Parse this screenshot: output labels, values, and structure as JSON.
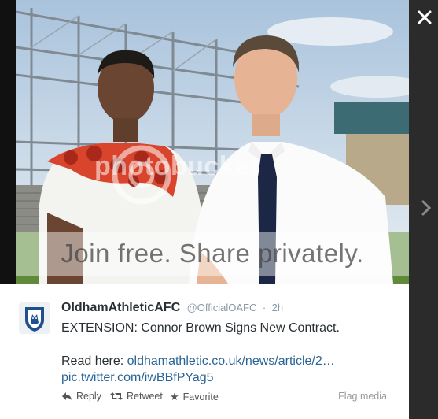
{
  "watermark": {
    "brand": "photobucket",
    "banner": "Join free. Share privately."
  },
  "lightbox": {
    "close_icon": "close-icon",
    "next_icon": "chevron-right-icon"
  },
  "tweet": {
    "display_name": "OldhamAthleticAFC",
    "handle": "@OfficialOAFC",
    "separator": "·",
    "time": "2h",
    "text_line1": "EXTENSION: Connor Brown Signs New Contract.",
    "read_here_label": "Read here: ",
    "article_link": "oldhamathletic.co.uk/news/article/2…",
    "pic_link": "pic.twitter.com/iwBBfPYag5",
    "actions": {
      "reply": "Reply",
      "retweet": "Retweet",
      "favorite": "Favorite",
      "flag_media": "Flag media"
    }
  },
  "colors": {
    "link": "#2a6496",
    "text": "#292f33",
    "muted": "#8899a6",
    "backdrop": "#2b2b2b"
  }
}
